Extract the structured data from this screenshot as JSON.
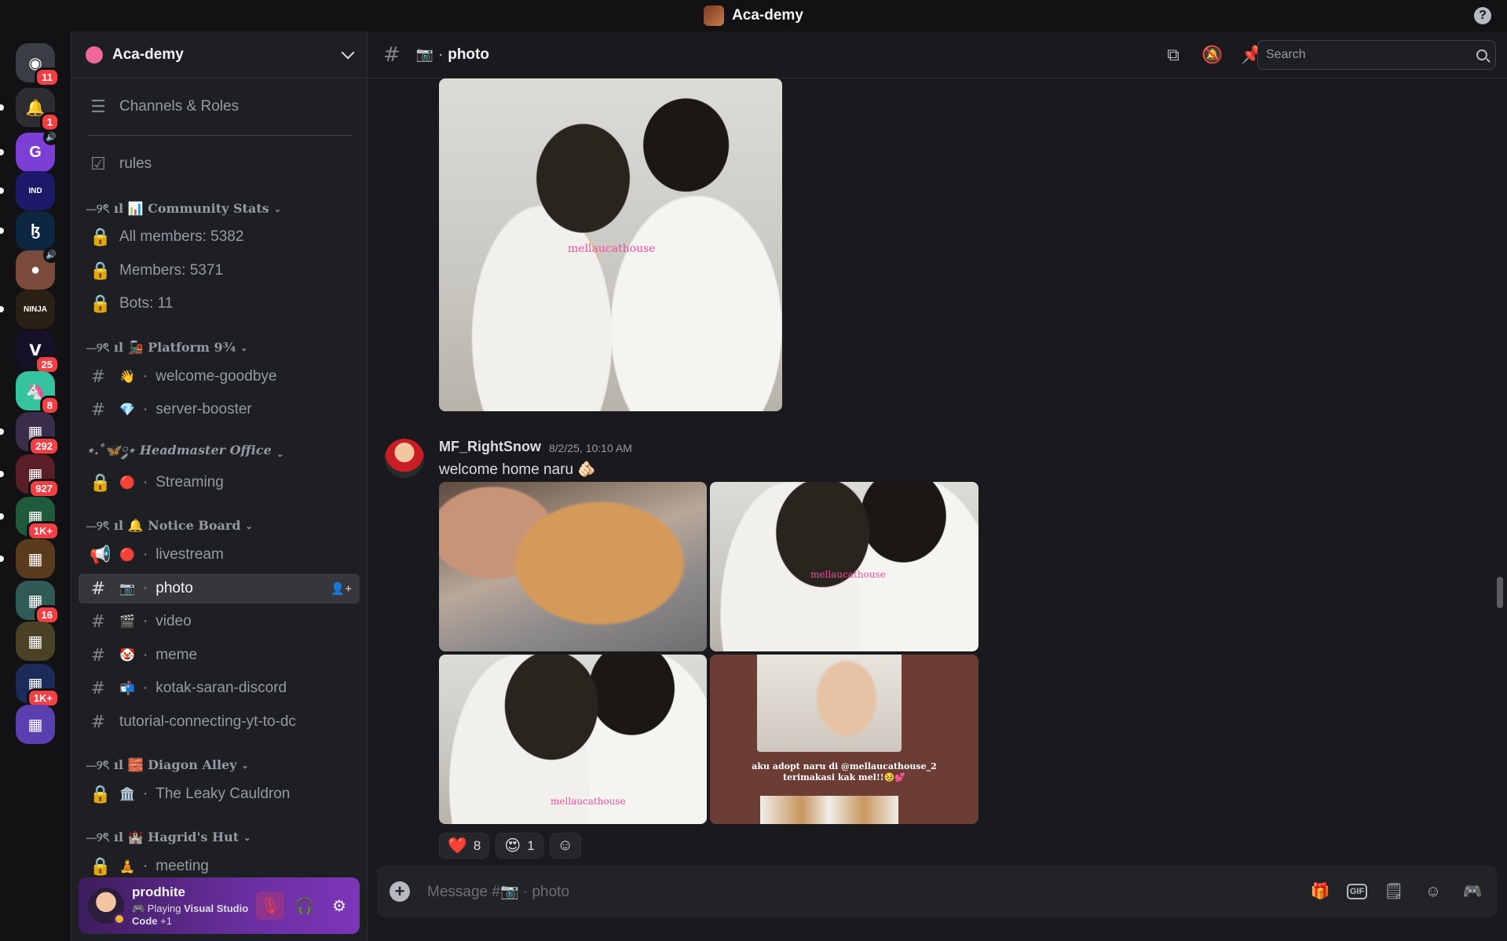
{
  "titlebar": {
    "title": "Aca-demy",
    "help": "?"
  },
  "rail": {
    "servers": [
      {
        "name": "home",
        "glyph": "◉",
        "bg": "#3b3d44",
        "badge": "11"
      },
      {
        "name": "notifications",
        "glyph": "🔔",
        "bg": "#2b2d31",
        "badge": "1"
      },
      {
        "name": "server-g",
        "glyph": "G",
        "bg": "#7b3fd6",
        "vol": "🔊"
      },
      {
        "name": "server-indsky",
        "glyph": "IND",
        "bg": "#1b1b6a"
      },
      {
        "name": "server-b",
        "glyph": "ɮ",
        "bg": "#0e2740"
      },
      {
        "name": "server-portrait",
        "glyph": "●",
        "bg": "#7a4b3a",
        "vol": "🔊"
      },
      {
        "name": "server-ninja",
        "glyph": "NINJA",
        "bg": "#2a2016"
      },
      {
        "name": "server-v",
        "glyph": "ᐯ",
        "bg": "#161129",
        "badge": "25"
      },
      {
        "name": "server-unicorn",
        "glyph": "🦄",
        "bg": "#35c4a0",
        "badge": "8"
      },
      {
        "name": "server-folder-1",
        "glyph": "▦",
        "bg": "#3a2d4c",
        "badge": "292"
      },
      {
        "name": "server-folder-2",
        "glyph": "▦",
        "bg": "#5a1e26",
        "badge": "927"
      },
      {
        "name": "server-folder-3",
        "glyph": "▦",
        "bg": "#1f5a3b",
        "badge": "1K+"
      },
      {
        "name": "server-folder-4",
        "glyph": "▦",
        "bg": "#5b3b1e"
      },
      {
        "name": "server-folder-5",
        "glyph": "▦",
        "bg": "#2f5a55",
        "badge": "16"
      },
      {
        "name": "server-folder-6",
        "glyph": "▦",
        "bg": "#4b4125"
      },
      {
        "name": "server-folder-7",
        "glyph": "▦",
        "bg": "#1b2b5a",
        "badge": "1K+"
      },
      {
        "name": "server-folder-8",
        "glyph": "▦",
        "bg": "#5a3fb0"
      }
    ]
  },
  "sidebar": {
    "server_name": "Aca-demy",
    "channels_roles": "Channels & Roles",
    "rules": "rules",
    "cat_stats": "⎯⎯୨ৎ ıl 📊 Community Stats",
    "all_members": "All members: 5382",
    "members": "Members: 5371",
    "bots": "Bots: 11",
    "cat_platform": "⎯⎯୨ৎ ıl 🚂 Platform 9¾",
    "welcome": "welcome-goodbye",
    "welcome_emoji": "👋",
    "booster": "server-booster",
    "booster_emoji": "💎",
    "cat_headmaster": "⋆.˚🦋༘⋆ Headmaster Office",
    "streaming": "Streaming",
    "streaming_emoji": "🔴",
    "cat_notice": "⎯⎯୨ৎ ıl 🔔 Notice Board",
    "livestream": "livestream",
    "livestream_emoji": "🔴",
    "photo": "photo",
    "photo_emoji": "📷",
    "video": "video",
    "video_emoji": "🎬",
    "meme": "meme",
    "meme_emoji": "🤡",
    "kotak": "kotak-saran-discord",
    "kotak_emoji": "📬",
    "tutorial": "tutorial-connecting-yt-to-dc",
    "cat_diagon": "⎯⎯୨ৎ ıl 🧱 Diagon Alley",
    "leaky": "The Leaky Cauldron",
    "leaky_emoji": "🏛️",
    "cat_hagrid": "⎯⎯୨ৎ ıl 🏰 Hagrid's Hut",
    "meeting": "meeting",
    "meeting_emoji": "🧘",
    "dot": "·"
  },
  "user": {
    "name": "prodhite",
    "activity_prefix": "🎮 Playing ",
    "activity_app": "Visual Studio Code",
    "activity_more": " +1"
  },
  "channel": {
    "emoji": "📷",
    "name": "photo",
    "search_placeholder": "Search"
  },
  "message": {
    "author": "MF_RightSnow",
    "timestamp": "8/2/25, 10:10 AM",
    "text": "welcome home naru 🫵🏻",
    "watermark": "mellaucathouse",
    "caption_line1": "aku adopt naru di @mellaucathouse_2",
    "caption_line2": "terimakasi kak mel!!🥹💕",
    "reactions": [
      {
        "emoji": "❤️",
        "count": "8"
      },
      {
        "emoji": "😍",
        "count": "1"
      }
    ]
  },
  "composer": {
    "placeholder": "Message #📷 · photo"
  },
  "colors": {
    "accent": "#5865f2",
    "danger": "#f23f43",
    "bg": "#1a1a1e"
  }
}
